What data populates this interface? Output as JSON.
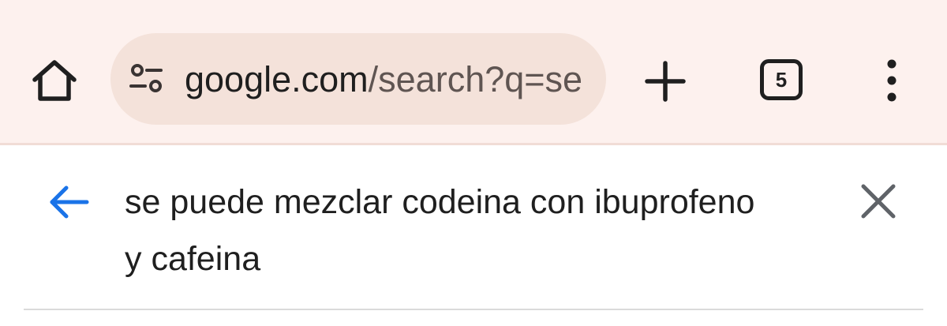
{
  "toolbar": {
    "url_host": "google.com",
    "url_path": "/search?q=se",
    "tab_count": "5"
  },
  "search": {
    "query_line1": "se puede mezclar codeina con ibuprofeno",
    "query_line2": "y cafeina"
  },
  "icons": {
    "home": "home-icon",
    "site_settings": "tune-icon",
    "new_tab": "plus-icon",
    "tab_switcher": "tab-count-icon",
    "menu": "more-vert-icon",
    "back": "arrow-back-icon",
    "clear": "close-icon"
  },
  "colors": {
    "toolbar_bg": "#fdf1ee",
    "omnibox_bg": "#f4e2da",
    "back_arrow": "#1a73e8",
    "clear_icon": "#5f6368"
  }
}
